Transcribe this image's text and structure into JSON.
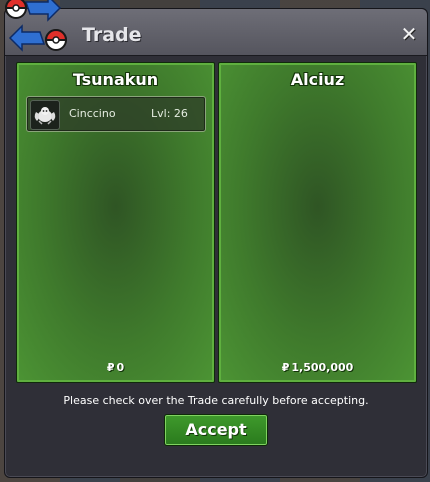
{
  "window": {
    "title": "Trade",
    "close_label": "✕",
    "logo_icon": "pokeball-swap-icon"
  },
  "panels": [
    {
      "player": "Tsunakun",
      "items": [
        {
          "name": "Cinccino",
          "level": "Lvl: 26",
          "icon": "cinccino-sprite-icon"
        }
      ],
      "currency_symbol": "₽",
      "money": "0"
    },
    {
      "player": "Alciuz",
      "items": [],
      "currency_symbol": "₽",
      "money": "1,500,000"
    }
  ],
  "notice": "Please check over the Trade carefully before accepting.",
  "accept_label": "Accept",
  "colors": {
    "panel_green": "#3f7a2c",
    "accept_green": "#3f9a2c",
    "titlebar": "#66666f",
    "window_bg": "#2f2f37"
  }
}
